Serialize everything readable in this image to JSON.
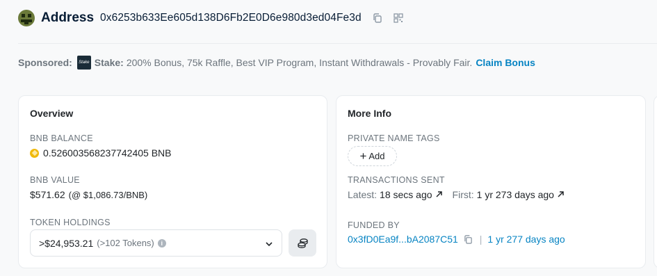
{
  "header": {
    "title": "Address",
    "address": "0x6253b633Ee605d138D6Fb2E0D6e980d3ed04Fe3d",
    "copy_icon": "copy-icon",
    "qr_icon": "qr-code-icon"
  },
  "sponsor": {
    "label": "Sponsored:",
    "brand": "Stake:",
    "logo_text": "Stake",
    "message": "200% Bonus, 75k Raffle, Best VIP Program, Instant Withdrawals - Provably Fair.",
    "cta": "Claim Bonus"
  },
  "overview": {
    "title": "Overview",
    "balance_label": "BNB BALANCE",
    "balance_value": "0.526003568237742405 BNB",
    "value_label": "BNB VALUE",
    "value_amount": "$571.62",
    "value_rate": "(@ $1,086.73/BNB)",
    "holdings_label": "TOKEN HOLDINGS",
    "holdings_amount": ">$24,953.21",
    "holdings_count": "(>102 Tokens)"
  },
  "more_info": {
    "title": "More Info",
    "tags_label": "PRIVATE NAME TAGS",
    "add_label": "Add",
    "tx_label": "TRANSACTIONS SENT",
    "latest_key": "Latest:",
    "latest_value": "18 secs ago",
    "first_key": "First:",
    "first_value": "1 yr 273 days ago",
    "funded_label": "FUNDED BY",
    "funded_address": "0x3fD0Ea9f...bA2087C51",
    "funded_age": "1 yr 277 days ago"
  },
  "colors": {
    "link": "#0784c3",
    "muted": "#6c757d",
    "bnb": "#f0b90b"
  }
}
